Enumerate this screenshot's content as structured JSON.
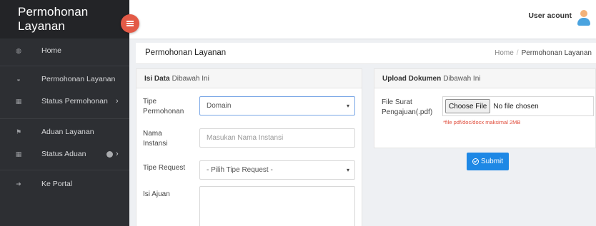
{
  "sidebar": {
    "brand": "Permohonan Layanan",
    "items": [
      {
        "label": "Home",
        "icon": "dashboard-icon"
      },
      {
        "label": "Permohonan Layanan",
        "icon": "globe-icon"
      },
      {
        "label": "Status Permohonan",
        "icon": "grid-icon",
        "chevron": "›"
      },
      {
        "label": "Aduan Layanan",
        "icon": "flag-icon"
      },
      {
        "label": "Status Aduan",
        "icon": "grid-icon",
        "chevron": "›"
      },
      {
        "label": "Ke Portal",
        "icon": "exit-icon"
      }
    ]
  },
  "topbar": {
    "user": "User acount"
  },
  "titlebar": {
    "title": "Permohonan Layanan",
    "breadcrumb": [
      "Home",
      "Permohonan Layanan"
    ]
  },
  "form": {
    "head_bold": "Isi Data",
    "head_rest": "Dibawah Ini",
    "fields": {
      "tipe_label": "Tipe Permohonan",
      "tipe_value": "Domain",
      "nama_label": "Nama Instansi",
      "nama_placeholder": "Masukan Nama Instansi",
      "request_label": "Tipe Request",
      "request_value": "- Pilih Tipe Request -",
      "ajuan_label": "Isi Ajuan"
    }
  },
  "upload": {
    "head_bold": "Upload Dokumen",
    "head_rest": "Dibawah Ini",
    "file_label": "File Surat Pengajuan(.pdf)",
    "file_button": "Choose File",
    "file_status": "No file chosen",
    "hint": "*file pdf/doc/docx maksimal 2MB"
  },
  "submit_label": "Submit",
  "colors": {
    "sidebar": "#2d2f33",
    "accent": "#1e88e5",
    "toggle": "#e35a47",
    "hint": "#e04b3a"
  }
}
